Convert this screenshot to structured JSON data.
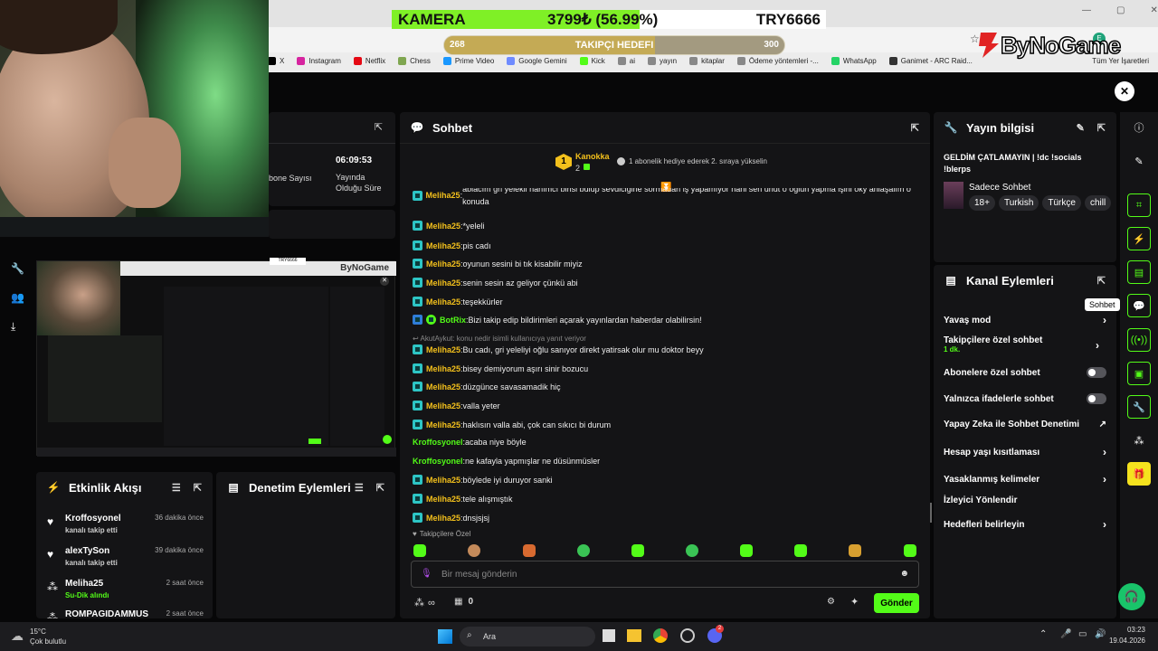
{
  "overlay": {
    "camera_label": "KAMERA",
    "camera_value": "3799₺ (56.99%)",
    "currency": "TRY6666",
    "goal_start": "268",
    "goal_title": "TAKIPÇI HEDEFI",
    "goal_end": "300",
    "goal_progress": 0.62,
    "bynogame_logo": "ByNoGame"
  },
  "bookmarks": [
    "X",
    "Instagram",
    "Netflix",
    "Chess",
    "Prime Video",
    "Google Gemini",
    "Kick",
    "ai",
    "yayın",
    "kitaplar",
    "Ödeme yöntemleri -...",
    "WhatsApp",
    "Ganimet - ARC Raid..."
  ],
  "bookmarks_overflow": "Tüm Yer İşaretleri",
  "stats": {
    "time": "06:09:53",
    "time_label": "Yayında Olduğu Süre",
    "subs_label": "bone Sayısı"
  },
  "mini_preview_currency": "TRY6666",
  "chat": {
    "title": "Sohbet",
    "pinned_user": "Kanokka",
    "pinned_count": "2",
    "pinned_rank": "1",
    "gift_text": "1 abonelik hediye ederek 2. sıraya yükselin",
    "messages": [
      {
        "user": "Meliha25",
        "text": "abiacım gri yelekli hanımcı birisi bulup sevdiciğine sormadan iş yapamıyor hani sen unut o oğlun yapma işini oky anlaşalım o konuda",
        "style": "sub"
      },
      {
        "user": "Meliha25",
        "text": "*yeleli",
        "style": "sub"
      },
      {
        "user": "Meliha25",
        "text": "pis cadı",
        "style": "sub"
      },
      {
        "user": "Meliha25",
        "text": "oyunun sesini bi tık kisabilir miyiz",
        "style": "sub"
      },
      {
        "user": "Meliha25",
        "text": "senin sesin az geliyor çünkü abi",
        "style": "sub"
      },
      {
        "user": "Meliha25",
        "text": "teşekkürler",
        "style": "sub"
      },
      {
        "user": "BotRix",
        "text": "Bizi takip edip bildirimleri açarak yayınlardan haberdar olabilirsin!",
        "style": "bot"
      },
      {
        "user": "",
        "text": "AkutAykut: konu nedir isimli kullanıcıya yanıt veriyor",
        "style": "reply"
      },
      {
        "user": "Meliha25",
        "text": "Bu cadı, gri yeleliyi oğlu sanıyor direkt yatirsak olur mu doktor beyy",
        "style": "sub"
      },
      {
        "user": "Meliha25",
        "text": "bisey demiyorum aşırı sinir bozucu",
        "style": "sub"
      },
      {
        "user": "Meliha25",
        "text": "düzgünce savasamadik hiç",
        "style": "sub"
      },
      {
        "user": "Meliha25",
        "text": "valla yeter",
        "style": "sub"
      },
      {
        "user": "Meliha25",
        "text": "haklısın valla abi, çok can sıkıcı bi durum",
        "style": "sub"
      },
      {
        "user": "Kroffosyonel",
        "text": "acaba niye böyle",
        "style": "green"
      },
      {
        "user": "Kroffosyonel",
        "text": "ne kafayla yapmışlar ne düsünmüsler",
        "style": "green"
      },
      {
        "user": "Meliha25",
        "text": "böylede iyi duruyor sanki",
        "style": "sub"
      },
      {
        "user": "Meliha25",
        "text": "tele alışmıştık",
        "style": "sub"
      },
      {
        "user": "Meliha25",
        "text": "dnsjsjsj",
        "style": "sub"
      }
    ],
    "followers_only": "Takipçilere Özel",
    "input_placeholder": "Bir mesaj gönderin",
    "points": "∞",
    "gift_count": "0",
    "send_label": "Gönder"
  },
  "activity": {
    "title": "Etkinlik Akışı",
    "events": [
      {
        "name": "Kroffosyonel",
        "time": "36 dakika önce",
        "desc": "kanalı takip etti"
      },
      {
        "name": "alexTySon",
        "time": "39 dakika önce",
        "desc": "kanalı takip etti"
      },
      {
        "name": "Meliha25",
        "time": "2 saat önce",
        "desc": "Su-Dik alındı"
      },
      {
        "name": "ROMPAGIDAMMUS",
        "time": "2 saat önce",
        "desc": ""
      }
    ]
  },
  "moderation": {
    "title": "Denetim Eylemleri"
  },
  "stream_info": {
    "title": "Yayın bilgisi",
    "stream_title": "GELDİM ÇATLAMAYIN | !dc !socials !blerps",
    "category": "Sadece Sohbet",
    "tags": [
      "18+",
      "Turkish",
      "Türkçe",
      "chill"
    ]
  },
  "channel_actions": {
    "title": "Kanal Eylemleri",
    "slow_mode": "Yavaş mod",
    "followers_chat": "Takipçilere özel sohbet",
    "followers_chat_sub": "1 dk.",
    "subs_chat": "Abonelere özel sohbet",
    "emotes_chat": "Yalnızca ifadelerle sohbet",
    "ai_moderation": "Yapay Zeka ile Sohbet Denetimi",
    "age_restrict": "Hesap yaşı kısıtlaması",
    "banned_words": "Yasaklanmış kelimeler",
    "raid": "İzleyici Yönlendir",
    "goals": "Hedefleri belirleyin"
  },
  "tooltip": "Sohbet",
  "taskbar": {
    "weather_temp": "15°C",
    "weather_desc": "Çok bulutlu",
    "search_label": "Ara",
    "time": "03:23",
    "date": "19.04.2026",
    "notif_count": "2"
  },
  "colors": {
    "accent": "#53fc18",
    "panel": "#141416",
    "gold": "#f3c01c"
  }
}
